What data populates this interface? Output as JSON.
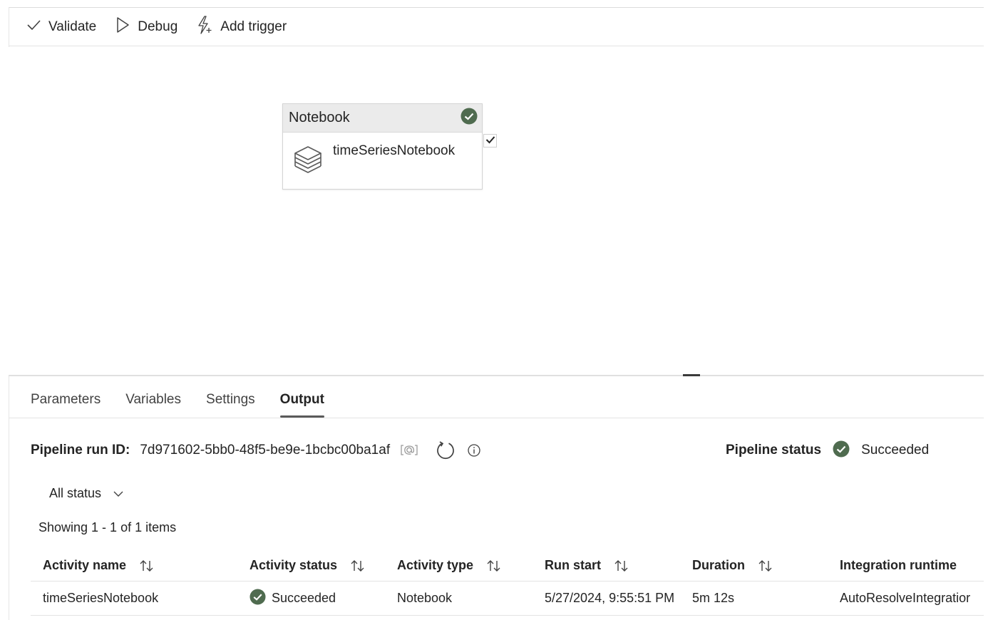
{
  "toolbar": {
    "validate_label": "Validate",
    "debug_label": "Debug",
    "add_trigger_label": "Add trigger"
  },
  "canvas": {
    "node": {
      "type": "Notebook",
      "name": "timeSeriesNotebook",
      "status": "succeeded"
    }
  },
  "tabs": [
    {
      "label": "Parameters",
      "active": false
    },
    {
      "label": "Variables",
      "active": false
    },
    {
      "label": "Settings",
      "active": false
    },
    {
      "label": "Output",
      "active": true
    }
  ],
  "run": {
    "id_label": "Pipeline run ID:",
    "id_value": "7d971602-5bb0-48f5-be9e-1bcbc00ba1af",
    "status_label": "Pipeline status",
    "status_value": "Succeeded"
  },
  "filter": {
    "selected": "All status"
  },
  "showing_text": "Showing 1 - 1 of 1 items",
  "table": {
    "columns": [
      "Activity name",
      "Activity status",
      "Activity type",
      "Run start",
      "Duration",
      "Integration runtime"
    ],
    "rows": [
      {
        "activity_name": "timeSeriesNotebook",
        "activity_status": "Succeeded",
        "activity_type": "Notebook",
        "run_start": "5/27/2024, 9:55:51 PM",
        "duration": "5m 12s",
        "integration_runtime": "AutoResolveIntegratior"
      }
    ]
  },
  "colors": {
    "success_green": "#4f6b4f",
    "text": "#242424",
    "border": "#e3e3e3"
  }
}
